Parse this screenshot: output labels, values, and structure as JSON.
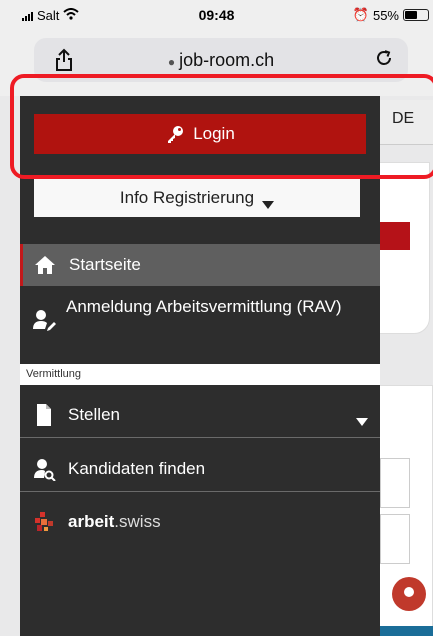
{
  "status_bar": {
    "carrier": "Salt",
    "time": "09:48",
    "battery_percent": "55%",
    "battery_level": 0.55
  },
  "browser": {
    "url": "job-room.ch",
    "share_icon": "share-icon",
    "reload_icon": "reload-icon"
  },
  "page": {
    "language": "DE"
  },
  "menu": {
    "login_label": "Login",
    "info_label": "Info Registrierung",
    "items": [
      {
        "label": "Startseite",
        "icon": "home-icon",
        "active": true
      },
      {
        "label": "Anmeldung Arbeitsvermittlung (RAV)",
        "icon": "user-edit-icon"
      }
    ],
    "section_label": "Vermittlung",
    "section_items": [
      {
        "label": "Stellen",
        "icon": "file-icon"
      },
      {
        "label": "Kandidaten finden",
        "icon": "user-search-icon"
      }
    ],
    "brand": {
      "bold": "arbeit",
      "light": ".swiss"
    }
  },
  "colors": {
    "accent": "#b0130f",
    "drawer_bg": "#2d2d2d",
    "active_bg": "#5f5f5f",
    "highlight": "#ee1b24"
  }
}
